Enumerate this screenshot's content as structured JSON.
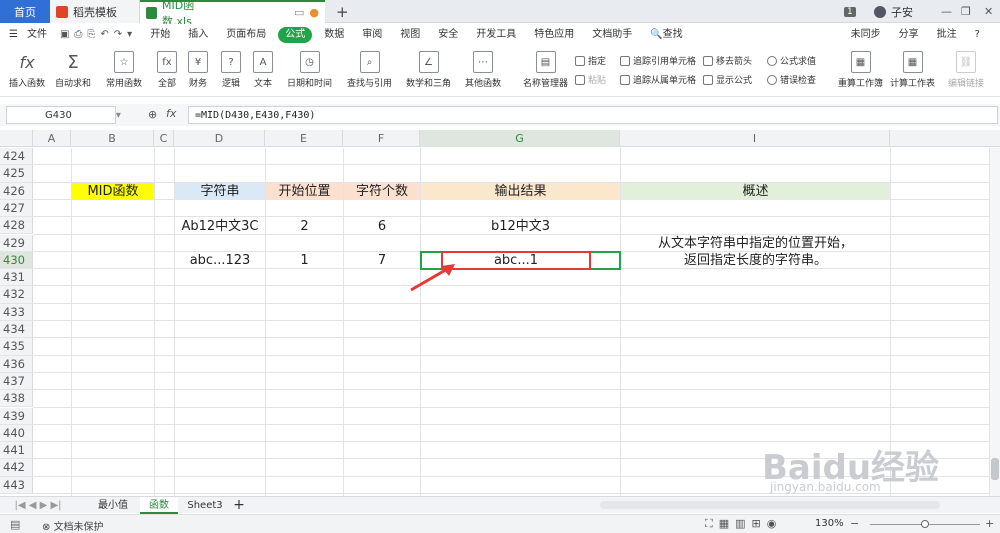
{
  "tabs": {
    "home": "首页",
    "template": "稻壳模板",
    "file": "MID函数.xls",
    "new_tab": "+"
  },
  "titlebar": {
    "badge": "1",
    "user": "子安"
  },
  "ribbon": {
    "file_menu": "文件",
    "tabs": [
      "开始",
      "插入",
      "页面布局",
      "公式",
      "数据",
      "审阅",
      "视图",
      "安全",
      "开发工具",
      "特色应用",
      "文档助手"
    ],
    "active_tab": "公式",
    "search": "查找",
    "sync": "未同步",
    "share": "分享",
    "comment": "批注"
  },
  "toolbar": {
    "insert_function": "插入函数",
    "autosum": "自动求和",
    "common": "常用函数",
    "all": "全部",
    "finance": "财务",
    "logic": "逻辑",
    "text": "文本",
    "datetime": "日期和时间",
    "lookup": "查找与引用",
    "math": "数学和三角",
    "other": "其他函数",
    "name_manager": "名称管理器",
    "specify": "指定",
    "paste": "粘贴",
    "trace_precedents": "追踪引用单元格",
    "trace_dependents": "追踪从属单元格",
    "remove_arrows": "移去箭头",
    "show_formulas": "显示公式",
    "evaluate": "公式求值",
    "error_check": "错误检查",
    "recalc_book": "重算工作簿",
    "calc_sheet": "计算工作表",
    "edit_links": "编辑链接"
  },
  "formula_bar": {
    "cell_ref": "G430",
    "fx": "fx",
    "formula": "=MID(D430,E430,F430)"
  },
  "columns": [
    "A",
    "B",
    "C",
    "D",
    "E",
    "F",
    "G",
    "I"
  ],
  "rows": [
    "424",
    "425",
    "426",
    "427",
    "428",
    "429",
    "430",
    "431",
    "432",
    "433",
    "434",
    "435",
    "436",
    "437",
    "438",
    "439",
    "440",
    "441",
    "442",
    "443"
  ],
  "cells": {
    "b426": "MID函数",
    "d426": "字符串",
    "e426": "开始位置",
    "f426": "字符个数",
    "g426": "输出结果",
    "i426": "概述",
    "d428": "Ab12中文3C",
    "e428": "2",
    "f428": "6",
    "g428": "b12中文3",
    "d430": "abc...123",
    "e430": "1",
    "f430": "7",
    "g430": "abc...1",
    "i429": "从文本字符串中指定的位置开始，",
    "i430": "返回指定长度的字符串。"
  },
  "colors": {
    "yellow": "#ffff00",
    "blue": "#dbe9f7",
    "orange": "#fbe0cf",
    "peach": "#fbe8cc",
    "green": "#e2efda",
    "active": "#22a34a",
    "arrow": "#e53935"
  },
  "sheets": [
    "最小值",
    "函数",
    "Sheet3"
  ],
  "active_sheet": "函数",
  "status": {
    "protect": "文档未保护",
    "zoom": "130%"
  },
  "watermark": {
    "logo": "Baidu经验",
    "url": "jingyan.baidu.com"
  }
}
